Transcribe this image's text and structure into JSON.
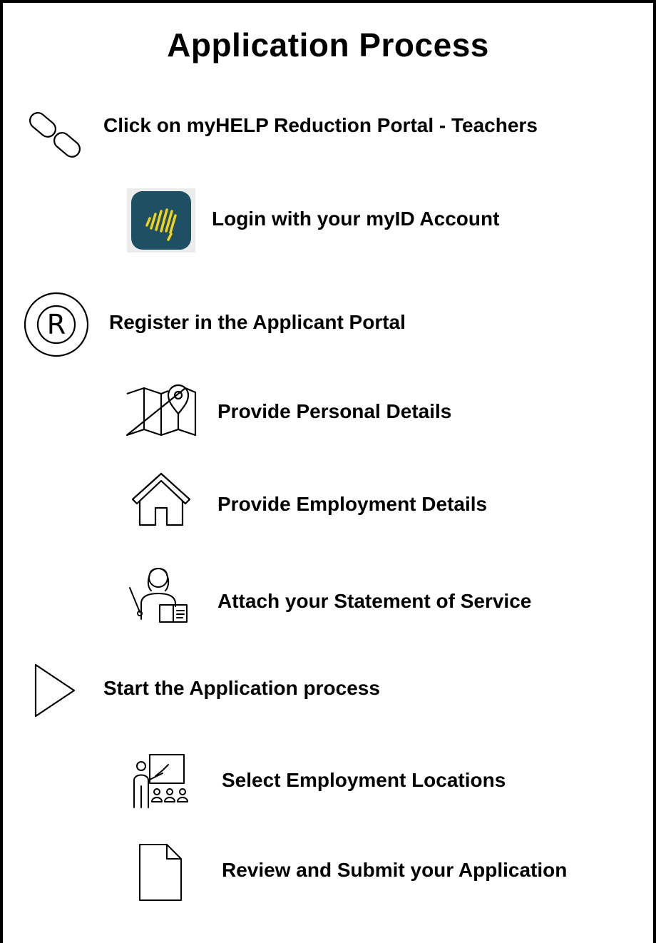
{
  "title": "Application Process",
  "steps": [
    {
      "label": "Click on myHELP Reduction Portal - Teachers",
      "icon": "link-icon"
    },
    {
      "label": "Login with your myID Account",
      "icon": "myid-app-icon"
    },
    {
      "label": "Register in the Applicant Portal",
      "icon": "registered-icon"
    },
    {
      "label": "Provide Personal Details",
      "icon": "map-pin-icon"
    },
    {
      "label": "Provide Employment Details",
      "icon": "house-icon"
    },
    {
      "label": "Attach your Statement of Service",
      "icon": "teacher-icon"
    },
    {
      "label": "Start the Application process",
      "icon": "play-icon"
    },
    {
      "label": "Select Employment Locations",
      "icon": "classroom-icon"
    },
    {
      "label": "Review and Submit your Application",
      "icon": "document-icon"
    }
  ],
  "colors": {
    "myid_tile": "#1e4f63",
    "myid_mark": "#f2d21b",
    "ink": "#000000"
  }
}
